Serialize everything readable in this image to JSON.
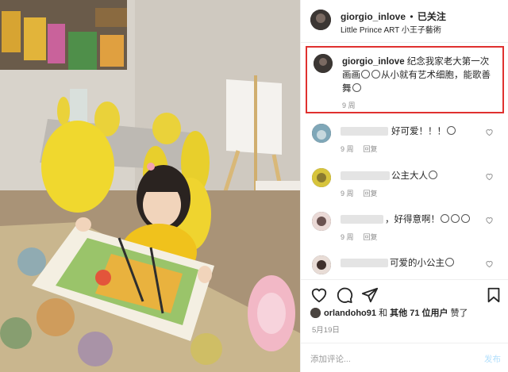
{
  "post": {
    "username": "giorgio_inlove",
    "follow_status": "已关注",
    "separator": "•",
    "location": "Little Prince ART 小王子藝術"
  },
  "caption": {
    "username": "giorgio_inlove",
    "text_part1": "纪念我家老大第一次画画",
    "text_part2": "从小就有艺术细胞，能歌善舞",
    "time": "9 周"
  },
  "comments": [
    {
      "text": "好可爱！！！",
      "time": "9 周",
      "reply": "回复"
    },
    {
      "text": "公主大人",
      "time": "9 周",
      "reply": "回复"
    },
    {
      "text": "，好得意啊！",
      "time": "9 周",
      "reply": "回复"
    },
    {
      "text": "可爱的小公主",
      "time": "",
      "reply": ""
    }
  ],
  "likes": {
    "user": "orlandoho91",
    "connector": " 和 ",
    "others": "其他 71 位用户",
    "suffix": " 赞了"
  },
  "date": "5月19日",
  "comment_input": {
    "placeholder": "添加评论...",
    "post_label": "发布"
  },
  "colors": {
    "highlight_border": "#e0312f",
    "muted_text": "#8e8e8e",
    "post_button": "#b2dffc"
  }
}
